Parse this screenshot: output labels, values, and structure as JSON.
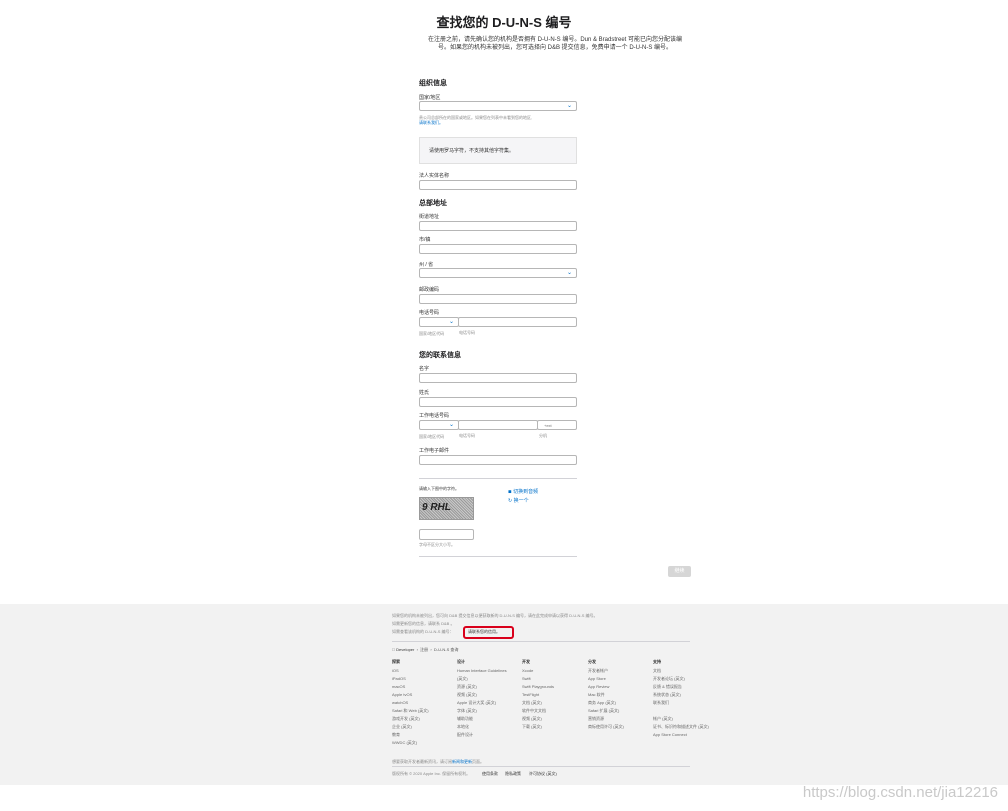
{
  "header": {
    "title": "查找您的 D-U-N-S 编号",
    "desc_line1": "在注册之前，请先确认您的机构是否拥有 D-U-N-S 编号。Dun & Bradstreet 可能已向您分配该编",
    "desc_line2": "号。如果您的机构未被列出，您可选择向 D&B 提交信息，免费申请一个 D-U-N-S 编号。"
  },
  "org": {
    "section_title": "组织信息",
    "country_label": "国家/地区",
    "country_hint": "贵公司总部所在的国家或地区。如果您在列表中未看到您的地区,",
    "country_link": "请联系我们。",
    "note": "请使用罗马字符，不支持其他字符集。",
    "legal_name_label": "法人实体名称"
  },
  "hq": {
    "section_title": "总部地址",
    "street_label": "街道地址",
    "city_label": "市/镇",
    "state_label": "州 / 省",
    "zip_label": "邮政编码",
    "phone_label": "电话号码",
    "phone_cc_hint": "国家/地区代码",
    "phone_num_hint": "电话号码"
  },
  "contact": {
    "section_title": "您的联系信息",
    "first_label": "名字",
    "last_label": "姓氏",
    "work_phone_label": "工作电话号码",
    "ext_placeholder": "+ext",
    "cc_hint": "国家/地区代码",
    "num_hint": "电话号码",
    "ext_hint": "分机",
    "email_label": "工作电子邮件"
  },
  "captcha": {
    "prompt": "请输入下图中的字符。",
    "code": "9 RHL",
    "switch_audio": "切换到音频",
    "new_one": "换一个",
    "case_hint": "字母不区分大小写。"
  },
  "actions": {
    "continue": "继续"
  },
  "footer": {
    "note1": "如果您的机构未被列出，您可向 D&B 提交信息以便获取新的 D-U-N-S 编号，请在此完成申请以获得 D-U-N-S 编号。",
    "note2": "如需更新您的信息，请联系 D&B 。",
    "note3": "如需查看该机构的 D-U-N-S 编号：",
    "note3_link": "请联系您的信用。",
    "crumb_logo": "Developer",
    "crumb_1": "注册",
    "crumb_2": "D-U-N-S 查询",
    "columns": [
      {
        "title": "探索",
        "items": [
          "iOS",
          "iPadOS",
          "macOS",
          "Apple tvOS",
          "watchOS",
          "Safari 和 Web (英文)",
          "游戏开发 (英文)",
          "企业 (英文)",
          "教育",
          "WWDC (英文)"
        ]
      },
      {
        "title": "设计",
        "items": [
          "Human Interface Guidelines",
          "(英文)",
          "资源 (英文)",
          "视频 (英文)",
          "Apple 设计大奖 (英文)",
          "字体 (英文)",
          "辅助功能",
          "本地化",
          "配件设计"
        ]
      },
      {
        "title": "开发",
        "items": [
          "Xcode",
          "Swift",
          "Swift Playgrounds",
          "TestFlight",
          "文档 (英文)",
          "软件中文文档",
          "视频 (英文)",
          "下载 (英文)"
        ]
      },
      {
        "title": "分发",
        "items": [
          "开发者帐户",
          "App Store",
          "App Review",
          "Mac 软件",
          "商务 App (英文)",
          "Safari 扩展 (英文)",
          "营销资源",
          "商标使用许可 (英文)"
        ]
      },
      {
        "title": "支持",
        "items": [
          "文档",
          "开发者论坛 (英文)",
          "反馈 & 错误报告",
          "系统状态 (英文)",
          "联系我们",
          "",
          "帐户 (英文)",
          "证书、标识符和描述文件 (英文)",
          "App Store Connect"
        ]
      }
    ],
    "newsletter": "想要获取开发者最新资讯，请订阅",
    "newsletter_link": "新闻和更新",
    "newsletter_tail": "页面。",
    "copyright": "版权所有 © 2020 Apple Inc. 保留所有权利。",
    "legal_1": "使用条款",
    "legal_2": "隐私政策",
    "legal_3": "许可协议 (英文)"
  },
  "watermark": "https://blog.csdn.net/jia12216"
}
